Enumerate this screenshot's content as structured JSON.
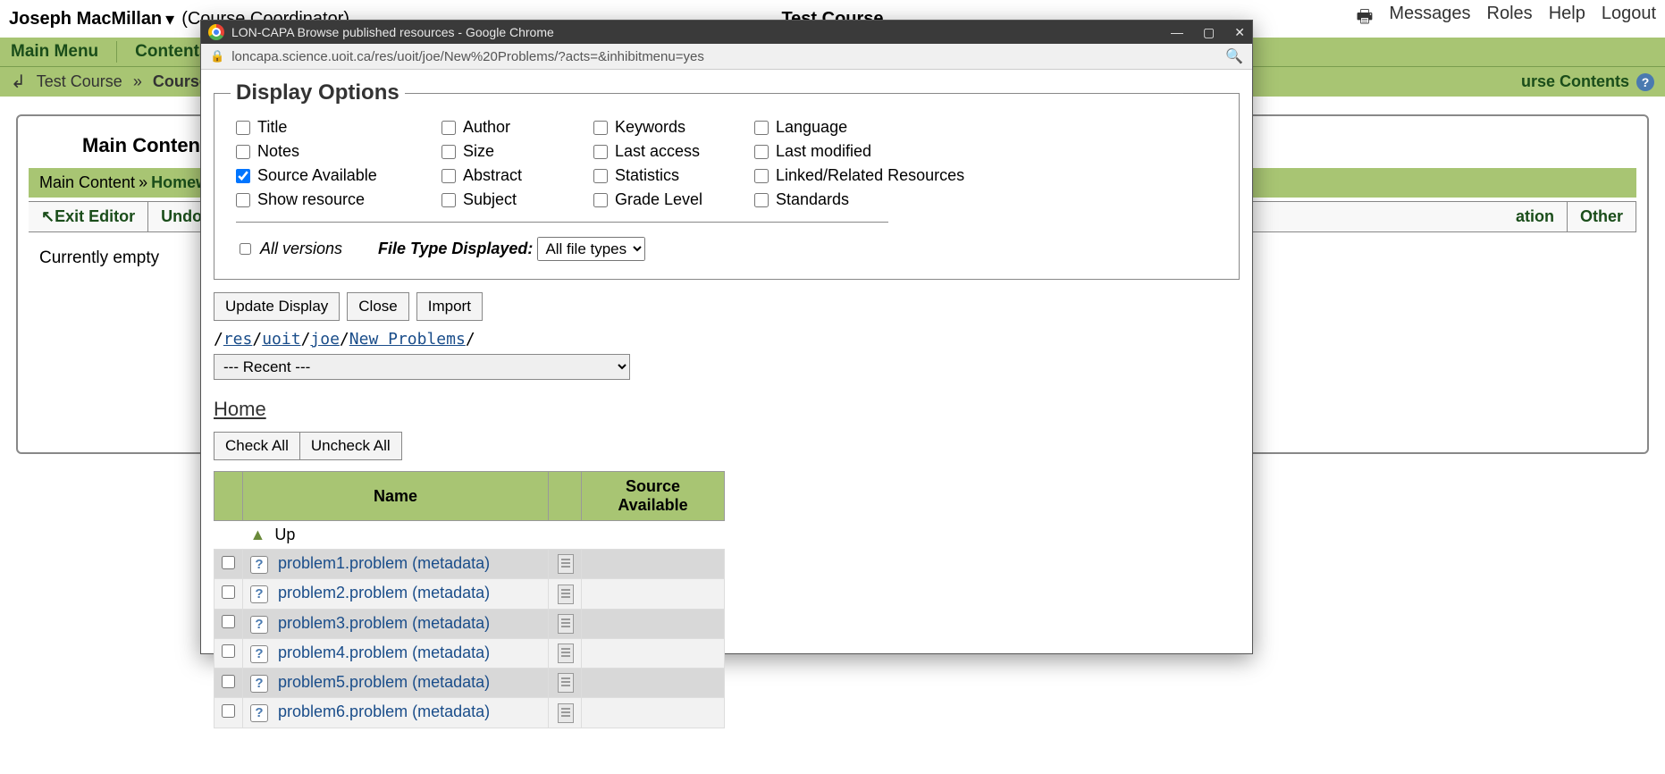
{
  "header": {
    "user_name": "Joseph MacMillan",
    "role": "(Course Coordinator)",
    "course_title": "Test Course",
    "links": [
      "Messages",
      "Roles",
      "Help",
      "Logout"
    ]
  },
  "menu_bar": {
    "main_menu": "Main Menu",
    "contents": "Contents"
  },
  "breadcrumb": {
    "back_arrow": "↲",
    "test_course": "Test Course",
    "sep": "»",
    "current": "Course",
    "right_label": "urse Contents"
  },
  "main_content": {
    "heading": "Main Content",
    "bc_main": "Main Content",
    "bc_sep": "»",
    "bc_current": "Homew",
    "tb_exit": "Exit Editor",
    "tb_undo": "Undo D",
    "tb_ation": "ation",
    "tb_other": "Other",
    "empty": "Currently empty"
  },
  "popup": {
    "title": "LON-CAPA Browse published resources - Google Chrome",
    "url": "loncapa.science.uoit.ca/res/uoit/joe/New%20Problems/?acts=&inhibitmenu=yes",
    "win_min": "—",
    "win_max": "▢",
    "win_close": "✕"
  },
  "display_options": {
    "legend": "Display Options",
    "checkboxes": [
      {
        "label": "Title",
        "checked": false
      },
      {
        "label": "Author",
        "checked": false
      },
      {
        "label": "Keywords",
        "checked": false
      },
      {
        "label": "Language",
        "checked": false
      },
      {
        "label": "Notes",
        "checked": false
      },
      {
        "label": "Size",
        "checked": false
      },
      {
        "label": "Last access",
        "checked": false
      },
      {
        "label": "Last modified",
        "checked": false
      },
      {
        "label": "Source Available",
        "checked": true
      },
      {
        "label": "Abstract",
        "checked": false
      },
      {
        "label": "Statistics",
        "checked": false
      },
      {
        "label": "Linked/Related Resources",
        "checked": false
      },
      {
        "label": "Show resource",
        "checked": false
      },
      {
        "label": "Subject",
        "checked": false
      },
      {
        "label": "Grade Level",
        "checked": false
      },
      {
        "label": "Standards",
        "checked": false
      }
    ],
    "all_versions_label": "All versions",
    "filetype_label": "File Type Displayed:",
    "filetype_value": "All file types"
  },
  "action_buttons": {
    "update": "Update Display",
    "close": "Close",
    "import": "Import"
  },
  "path": {
    "root": "/",
    "parts": [
      "res",
      "uoit",
      "joe",
      "New Problems"
    ],
    "trail": "/"
  },
  "recent": {
    "selected": "--- Recent ---"
  },
  "home_link": "Home",
  "check_buttons": {
    "check_all": "Check All",
    "uncheck_all": "Uncheck All"
  },
  "table": {
    "col_name": "Name",
    "col_source": "Source Available",
    "up_label": "Up",
    "rows": [
      {
        "file": "problem1.problem",
        "meta": "(metadata)"
      },
      {
        "file": "problem2.problem",
        "meta": "(metadata)"
      },
      {
        "file": "problem3.problem",
        "meta": "(metadata)"
      },
      {
        "file": "problem4.problem",
        "meta": "(metadata)"
      },
      {
        "file": "problem5.problem",
        "meta": "(metadata)"
      },
      {
        "file": "problem6.problem",
        "meta": "(metadata)"
      }
    ]
  }
}
